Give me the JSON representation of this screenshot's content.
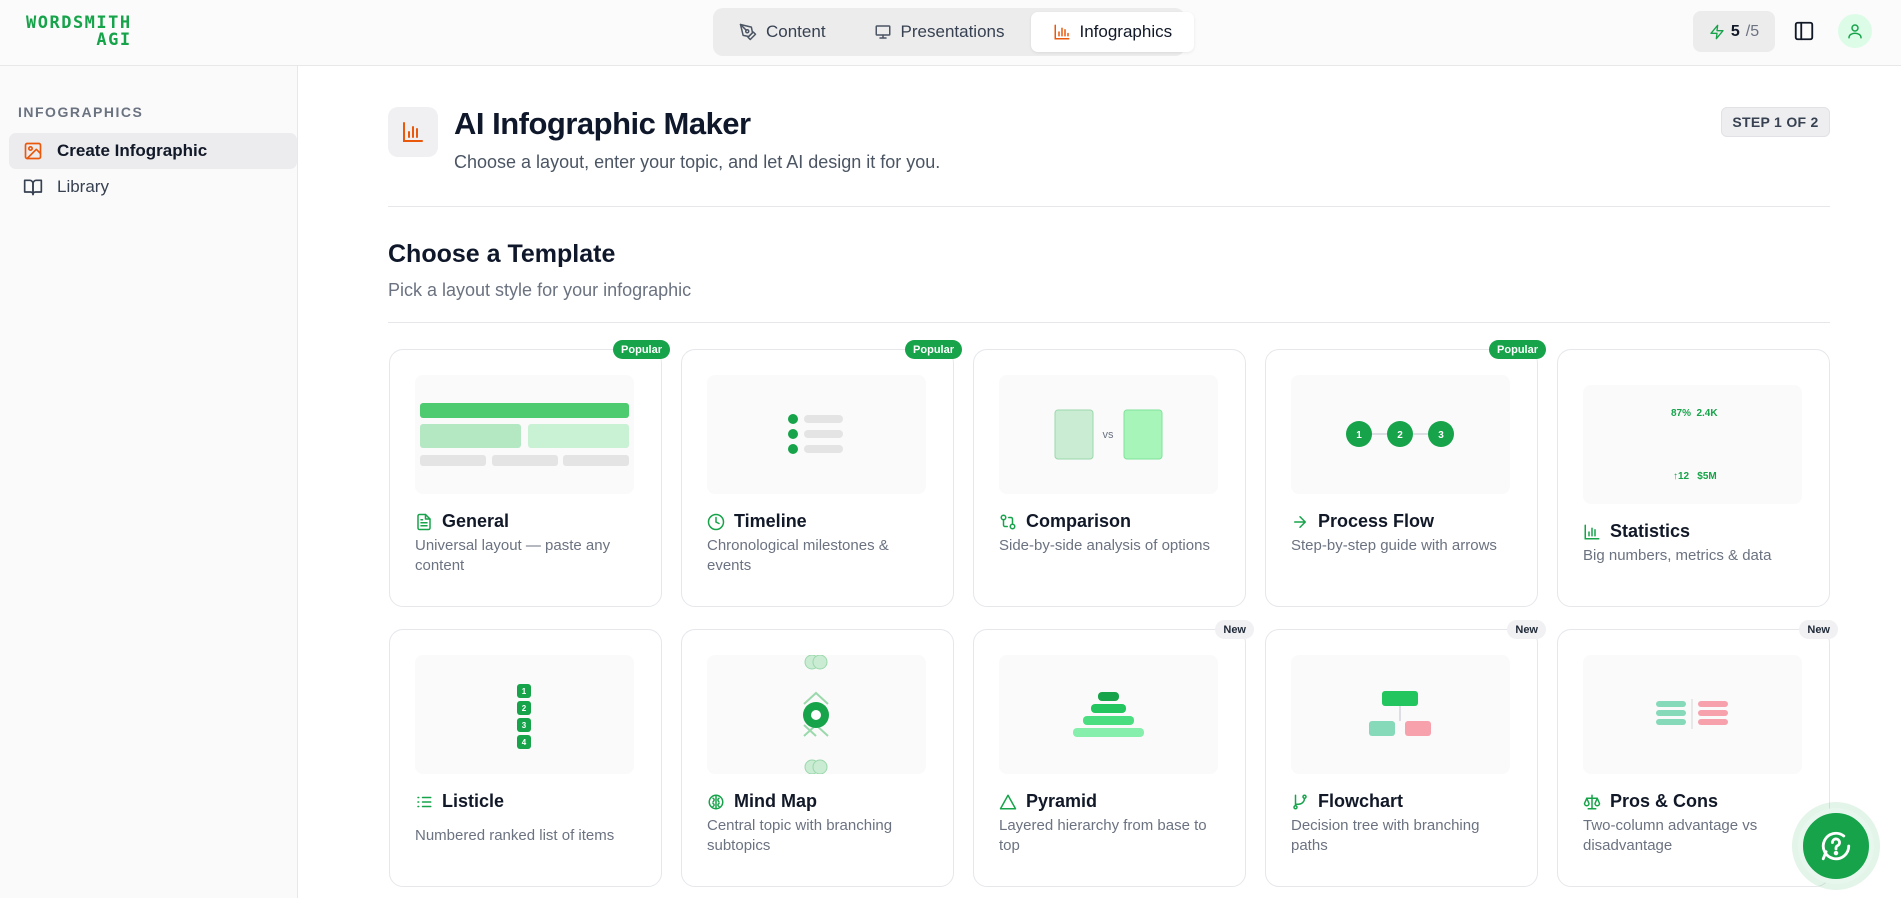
{
  "app": {
    "logo_line1": "WORDSMITH",
    "logo_line2": "AGI",
    "brand_color": "#16a34a",
    "accent_color": "#ea580c"
  },
  "nav": {
    "tabs": [
      {
        "label": "Content",
        "icon": "pen-icon",
        "active": false
      },
      {
        "label": "Presentations",
        "icon": "presentation-icon",
        "active": false
      },
      {
        "label": "Infographics",
        "icon": "bar-chart-icon",
        "active": true
      }
    ]
  },
  "credits": {
    "used": "5",
    "total": "/5"
  },
  "sidebar": {
    "heading": "INFOGRAPHICS",
    "items": [
      {
        "label": "Create Infographic",
        "icon": "image-icon",
        "active": true
      },
      {
        "label": "Library",
        "icon": "book-icon",
        "active": false
      }
    ]
  },
  "header": {
    "title": "AI Infographic Maker",
    "subtitle": "Choose a layout, enter your topic, and let AI design it for you.",
    "step": "STEP 1 OF 2"
  },
  "section": {
    "title": "Choose a Template",
    "subtitle": "Pick a layout style for your infographic"
  },
  "templates": [
    {
      "title": "General",
      "desc": "Universal layout — paste any content",
      "badge": "Popular",
      "icon": "document-icon"
    },
    {
      "title": "Timeline",
      "desc": "Chronological milestones & events",
      "badge": "Popular",
      "icon": "clock-icon"
    },
    {
      "title": "Comparison",
      "desc": "Side-by-side analysis of options",
      "badge": "",
      "icon": "compare-icon",
      "preview_text": "vs"
    },
    {
      "title": "Process Flow",
      "desc": "Step-by-step guide with arrows",
      "badge": "Popular",
      "icon": "arrow-right-icon",
      "preview_steps": [
        "1",
        "2",
        "3"
      ]
    },
    {
      "title": "Statistics",
      "desc": "Big numbers, metrics & data",
      "badge": "",
      "icon": "bar-chart-icon",
      "preview_stats": [
        "87%",
        "2.4K",
        "↑12",
        "$5M"
      ]
    },
    {
      "title": "Listicle",
      "desc": "Numbered ranked list of items",
      "badge": "",
      "icon": "list-icon",
      "preview_numbers": [
        "1",
        "2",
        "3",
        "4"
      ]
    },
    {
      "title": "Mind Map",
      "desc": "Central topic with branching subtopics",
      "badge": "",
      "icon": "brain-icon"
    },
    {
      "title": "Pyramid",
      "desc": "Layered hierarchy from base to top",
      "badge": "New",
      "icon": "triangle-icon"
    },
    {
      "title": "Flowchart",
      "desc": "Decision tree with branching paths",
      "badge": "New",
      "icon": "git-branch-icon"
    },
    {
      "title": "Pros & Cons",
      "desc": "Two-column advantage vs disadvantage",
      "badge": "New",
      "icon": "scale-icon"
    }
  ]
}
